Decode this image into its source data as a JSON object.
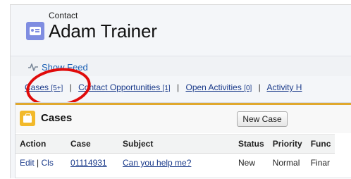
{
  "header": {
    "object_label": "Contact",
    "record_name": "Adam Trainer"
  },
  "feed": {
    "show_feed_label": "Show Feed"
  },
  "related_list_links": [
    {
      "label": "Cases",
      "count": "[5+]"
    },
    {
      "label": "Contact Opportunities",
      "count": "[1]"
    },
    {
      "label": "Open Activities",
      "count": "[0]"
    },
    {
      "label": "Activity H",
      "count": ""
    }
  ],
  "separator": "|",
  "cases": {
    "title": "Cases",
    "new_case_label": "New Case",
    "columns": [
      "Action",
      "Case",
      "Subject",
      "Status",
      "Priority",
      "Func"
    ],
    "rows": [
      {
        "action_edit": "Edit",
        "action_sep": "|",
        "action_cls": "Cls",
        "case": "01114931",
        "subject": "Can you help me?",
        "status": "New",
        "priority": "Normal",
        "func": "Finar"
      }
    ]
  },
  "colors": {
    "contact_icon": "#7f8de1",
    "case_icon": "#f2b92a",
    "highlight_circle": "#e00b0b",
    "link": "#1a3a8a"
  },
  "icons": {
    "contact": "contact-card-icon",
    "feed": "feed-pulse-icon",
    "cases": "briefcase-icon"
  }
}
